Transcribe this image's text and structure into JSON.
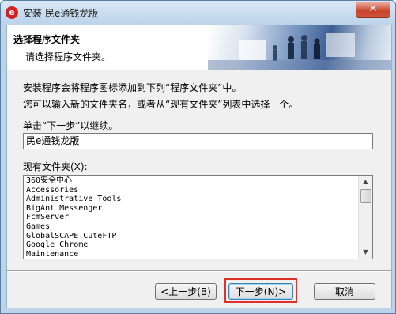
{
  "window": {
    "title": "安装 民e通钱龙版",
    "close_glyph": "✕",
    "app_icon_glyph": "e"
  },
  "header": {
    "title": "选择程序文件夹",
    "subtitle": "请选择程序文件夹。"
  },
  "body": {
    "line1": "安装程序会将程序图标添加到下列“程序文件夹”中。",
    "line2": "您可以输入新的文件夹名，或者从“现有文件夹”列表中选择一个。",
    "line3": "单击“下一步”以继续。"
  },
  "folder_input": {
    "value": "民e通钱龙版"
  },
  "existing_label": "现有文件夹(X):",
  "existing_folders": [
    "360安全中心",
    "Accessories",
    "Administrative Tools",
    "BigAnt Messenger",
    "FcmServer",
    "Games",
    "GlobalSCAPE CuteFTP",
    "Google Chrome",
    "Maintenance"
  ],
  "buttons": {
    "back": "<上一步(B)",
    "next": "下一步(N)>",
    "cancel": "取消"
  },
  "colors": {
    "highlight": "#e0302a",
    "title_bar": "#bcd3ea"
  }
}
